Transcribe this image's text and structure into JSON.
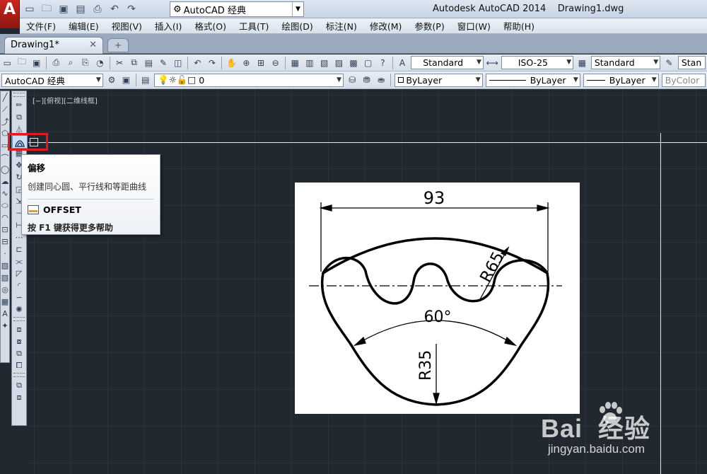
{
  "window": {
    "app_letter": "A",
    "workspace": "AutoCAD 经典",
    "title": "Autodesk AutoCAD 2014    Drawing1.dwg"
  },
  "menu": [
    "文件(F)",
    "编辑(E)",
    "视图(V)",
    "插入(I)",
    "格式(O)",
    "工具(T)",
    "绘图(D)",
    "标注(N)",
    "修改(M)",
    "参数(P)",
    "窗口(W)",
    "帮助(H)"
  ],
  "tabs": {
    "active": "Drawing1*",
    "close": "✕"
  },
  "styles": {
    "text_style": "Standard",
    "dim_style": "ISO-25",
    "table_style": "Standard",
    "multileader_style": "Stan"
  },
  "layers": {
    "workspace_combo": "AutoCAD 经典",
    "layer_value": "0",
    "color": "ByLayer",
    "linetype": "ByLayer",
    "lineweight": "ByLayer",
    "plot_style": "ByColor"
  },
  "viewport": {
    "label": "[−][俯视][二维线框]"
  },
  "tooltip": {
    "title": "偏移",
    "description": "创建同心圆、平行线和等距曲线",
    "command": "OFFSET",
    "help": "按 F1 键获得更多帮助"
  },
  "drawing": {
    "dim_width": "93",
    "dim_radius_large": "R65",
    "dim_angle": "60°",
    "dim_radius_small": "R35"
  },
  "watermark": {
    "logo": "Bai  经验",
    "url": "jingyan.baidu.com"
  },
  "colors": {
    "canvas": "#212830",
    "highlight": "#e01b24"
  }
}
